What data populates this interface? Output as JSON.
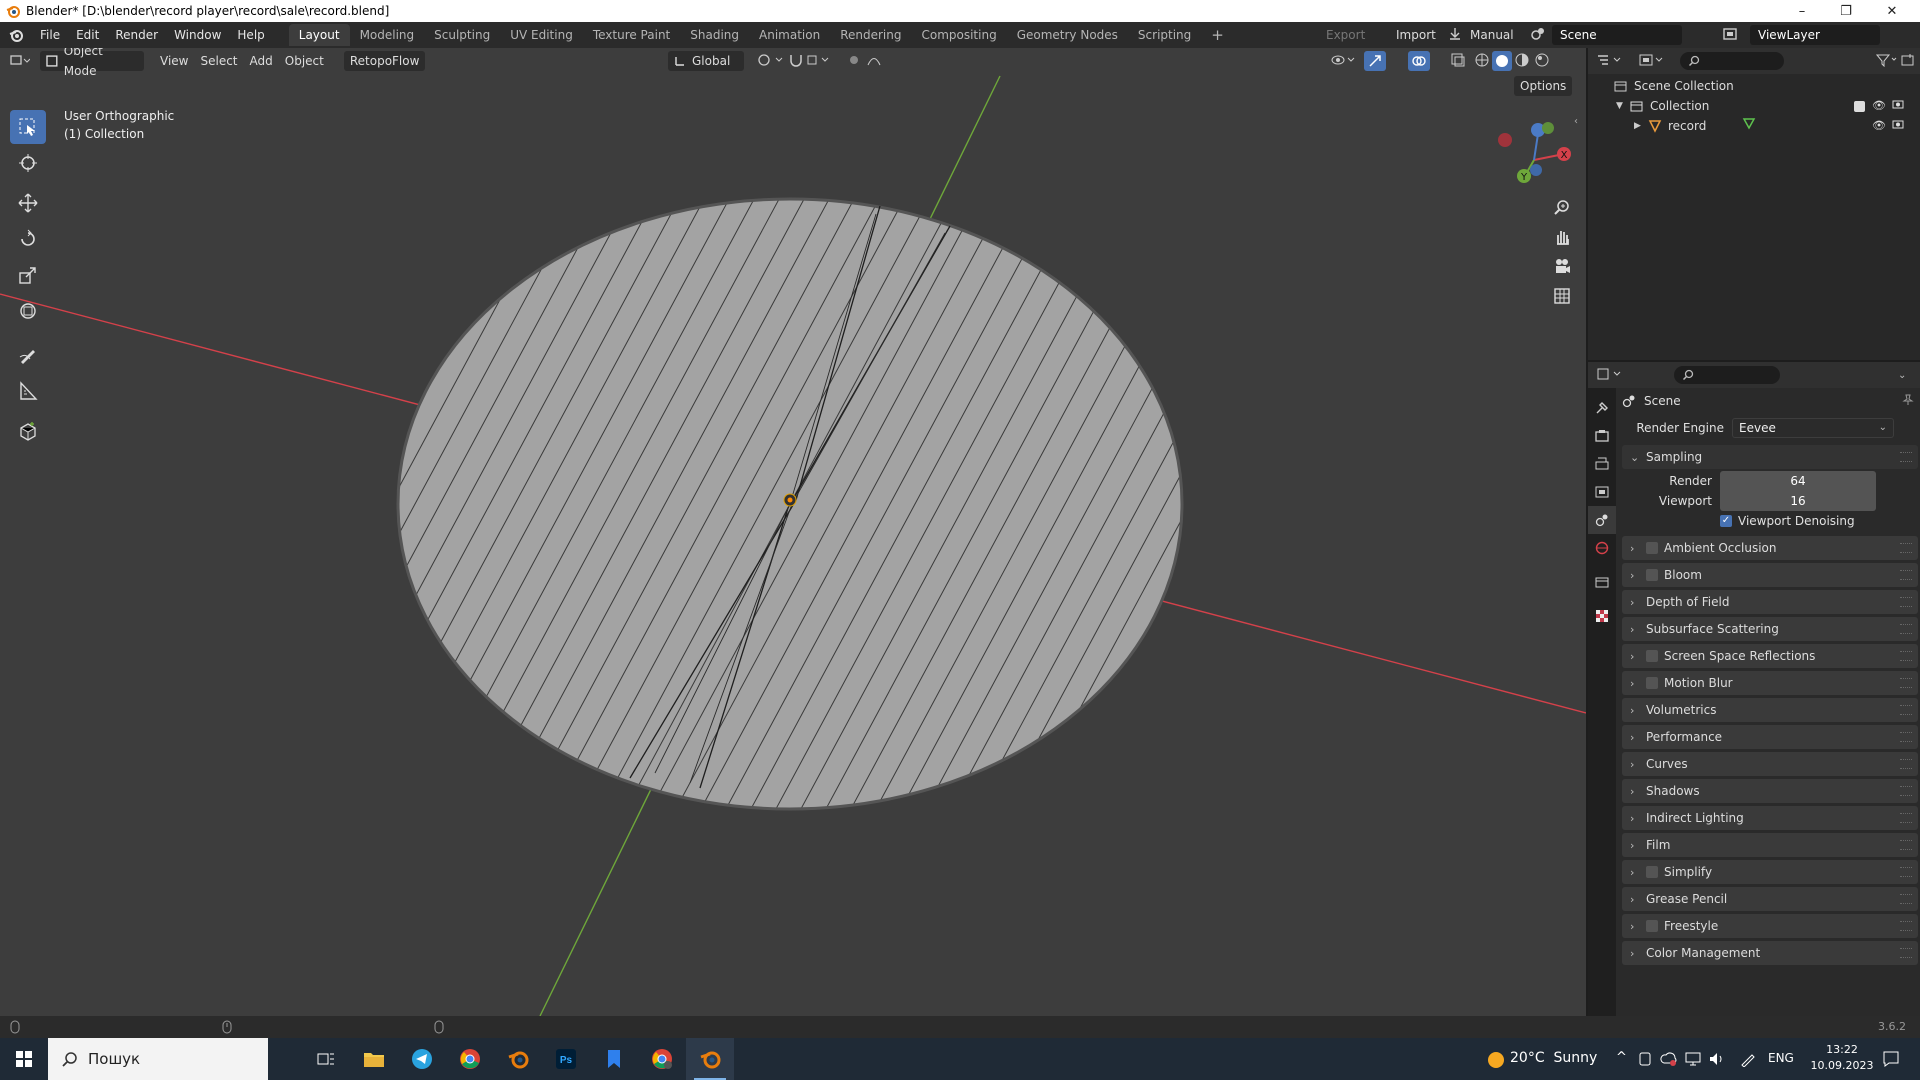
{
  "window": {
    "title": "Blender* [D:\\blender\\record player\\record\\sale\\record.blend]",
    "minimize": "–",
    "restore": "❐",
    "close": "✕"
  },
  "menu": {
    "items": [
      "File",
      "Edit",
      "Render",
      "Window",
      "Help"
    ]
  },
  "workspaces": {
    "tabs": [
      "Layout",
      "Modeling",
      "Sculpting",
      "UV Editing",
      "Texture Paint",
      "Shading",
      "Animation",
      "Rendering",
      "Compositing",
      "Geometry Nodes",
      "Scripting"
    ],
    "add": "+"
  },
  "topright": {
    "export": "Export",
    "import": "Import",
    "manual": "Manual",
    "scene": "Scene",
    "viewlayer": "ViewLayer"
  },
  "viewport": {
    "mode": "Object Mode",
    "menus": [
      "View",
      "Select",
      "Add",
      "Object"
    ],
    "addon": "RetopoFlow",
    "orientation": "Global",
    "options": "Options",
    "view_name": "User Orthographic",
    "collection_info": "(1) Collection",
    "gizmo": {
      "x": "X",
      "y": "Y",
      "z": "Z"
    }
  },
  "outliner": {
    "root": "Scene Collection",
    "collection": "Collection",
    "object": "record"
  },
  "properties": {
    "scene_label": "Scene",
    "render_engine_label": "Render Engine",
    "render_engine_value": "Eevee",
    "sampling": {
      "title": "Sampling",
      "render_label": "Render",
      "render_value": "64",
      "viewport_label": "Viewport",
      "viewport_value": "16",
      "denoise_label": "Viewport Denoising"
    },
    "sections": [
      {
        "label": "Ambient Occlusion",
        "checkbox": true
      },
      {
        "label": "Bloom",
        "checkbox": true
      },
      {
        "label": "Depth of Field",
        "checkbox": false
      },
      {
        "label": "Subsurface Scattering",
        "checkbox": false
      },
      {
        "label": "Screen Space Reflections",
        "checkbox": true
      },
      {
        "label": "Motion Blur",
        "checkbox": true
      },
      {
        "label": "Volumetrics",
        "checkbox": false
      },
      {
        "label": "Performance",
        "checkbox": false
      },
      {
        "label": "Curves",
        "checkbox": false
      },
      {
        "label": "Shadows",
        "checkbox": false
      },
      {
        "label": "Indirect Lighting",
        "checkbox": false
      },
      {
        "label": "Film",
        "checkbox": false
      },
      {
        "label": "Simplify",
        "checkbox": true
      },
      {
        "label": "Grease Pencil",
        "checkbox": false
      },
      {
        "label": "Freestyle",
        "checkbox": true
      },
      {
        "label": "Color Management",
        "checkbox": false
      }
    ]
  },
  "statusbar": {
    "version": "3.6.2"
  },
  "taskbar": {
    "search_placeholder": "Пошук",
    "weather": "20°C  Sunny",
    "lang": "ENG",
    "time": "13:22",
    "date": "10.09.2023"
  },
  "colors": {
    "accent": "#4772b3",
    "x_axis": "#d4414a",
    "y_axis": "#6ea73a",
    "disc": "#a3a3a3",
    "viewport_bg": "#3d3d3d"
  }
}
